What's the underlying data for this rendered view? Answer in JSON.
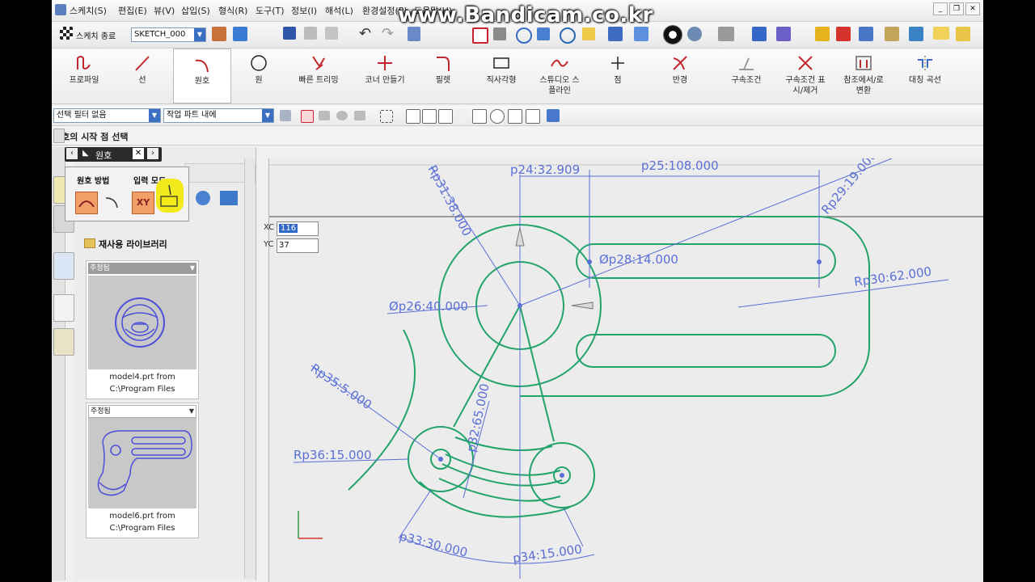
{
  "watermark": "www.Bandicam.co.kr",
  "menubar": {
    "items": [
      "스케치(S)",
      "편집(E)",
      "뷰(V)",
      "삽입(S)",
      "형식(R)",
      "도구(T)",
      "정보(I)",
      "해석(L)",
      "환경설정(P)",
      "도움말(H)"
    ]
  },
  "toolbar1": {
    "finish_sketch_label": "스케치 종료",
    "sketch_name": "SKETCH_000"
  },
  "ribbon": {
    "items": [
      {
        "label": "프로파일"
      },
      {
        "label": "선"
      },
      {
        "label": "원호"
      },
      {
        "label": "원"
      },
      {
        "label": "빠른 트리밍"
      },
      {
        "label": "코너 만들기"
      },
      {
        "label": "필렛"
      },
      {
        "label": "직사각형"
      },
      {
        "label": "스튜디오 스\n플라인"
      },
      {
        "label": "점"
      },
      {
        "label": "반경"
      },
      {
        "label": "구속조건"
      },
      {
        "label": "구속조건 표\n시/제거"
      },
      {
        "label": "참조에서/로\n변환"
      },
      {
        "label": "대칭 곡선"
      }
    ]
  },
  "toolbar3": {
    "selection_filter": "선택 필터 없음",
    "scope": "작업 파트 내에"
  },
  "cue_line": "원호의 시작 점 선택",
  "popup": {
    "title": "원호",
    "method_label": "원호 방법",
    "input_mode_label": "입력 모드",
    "xy_label": "XY"
  },
  "coords": {
    "xc_label": "XC",
    "xc_value": "116",
    "yc_label": "YC",
    "yc_value": "37"
  },
  "navigator": {
    "title": "재사용 라이브러리",
    "cards": [
      {
        "header": "주정됨",
        "caption1": "model4.prt from",
        "caption2": "C:\\Program Files"
      },
      {
        "header": "주정됨",
        "caption1": "model6.prt from",
        "caption2": "C:\\Program Files"
      }
    ]
  },
  "dimensions": {
    "p24": "p24:32.909",
    "p25": "p25:108.000",
    "p31": "Rp31:38.000",
    "p28": "Øp28:14.000",
    "p29": "Rp29:19.000",
    "p26": "Øp26:40.000",
    "p30": "Rp30:62.000",
    "p35": "Rp35:5.000",
    "p36": "Rp36:15.000",
    "p32": "p32:65.000",
    "p33": "p33:30.000",
    "p34": "p34:15.000"
  },
  "colors": {
    "sketch_green": "#22a36a",
    "dim_blue": "#5b6fd6",
    "accent_yellow": "#f2ea1b"
  }
}
